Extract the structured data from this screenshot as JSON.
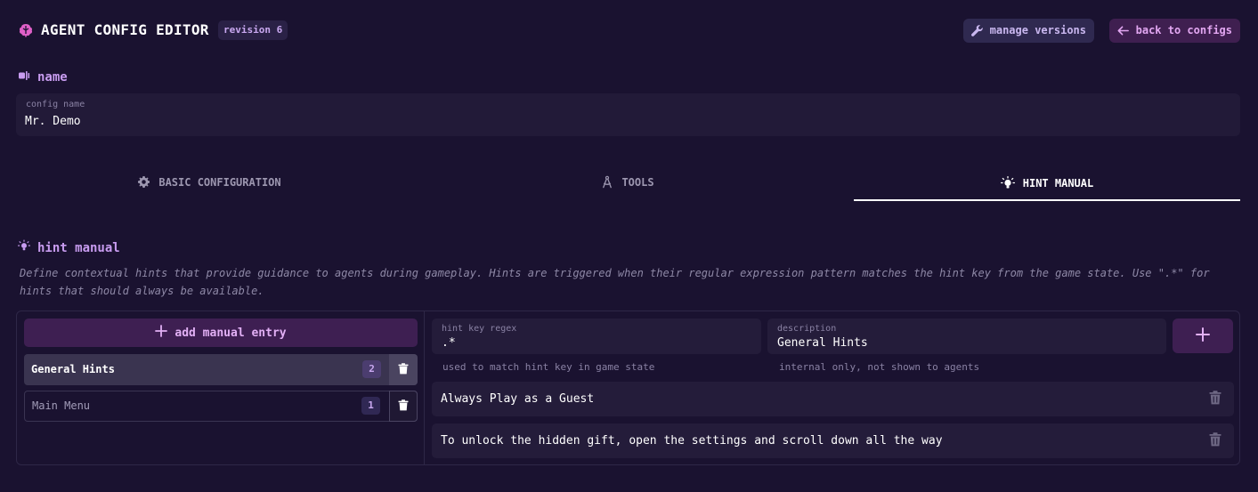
{
  "header": {
    "app_title": "AGENT CONFIG EDITOR",
    "revision_badge": "revision 6",
    "manage_versions_label": "manage versions",
    "back_to_configs_label": "back to configs"
  },
  "name_section": {
    "title": "name",
    "field_label": "config name",
    "field_value": "Mr. Demo"
  },
  "tabs": [
    {
      "label": "BASIC CONFIGURATION",
      "icon": "gear-icon",
      "active": false
    },
    {
      "label": "TOOLS",
      "icon": "compass-icon",
      "active": false
    },
    {
      "label": "HINT MANUAL",
      "icon": "lightbulb-icon",
      "active": true
    }
  ],
  "hint_manual": {
    "title": "hint manual",
    "description": "Define contextual hints that provide guidance to agents during gameplay. Hints are triggered when their regular expression pattern matches the hint key from the game state. Use \".*\" for hints that should always be available.",
    "add_entry_label": "add manual entry",
    "entries": [
      {
        "label": "General Hints",
        "count": "2",
        "selected": true
      },
      {
        "label": "Main Menu",
        "count": "1",
        "selected": false
      }
    ],
    "regex_field": {
      "label": "hint key regex",
      "value": ".*",
      "helper": "used to match hint key in game state"
    },
    "description_field": {
      "label": "description",
      "value": "General Hints",
      "helper": "internal only, not shown to agents"
    },
    "hints": [
      "Always Play as a Guest",
      "To unlock the hidden gift, open the settings and scroll down all the way"
    ]
  },
  "colors": {
    "background": "#1a1230",
    "accent": "#c89cf0",
    "brand_pink": "#e060c8",
    "button_purple": "#3e1f52"
  }
}
